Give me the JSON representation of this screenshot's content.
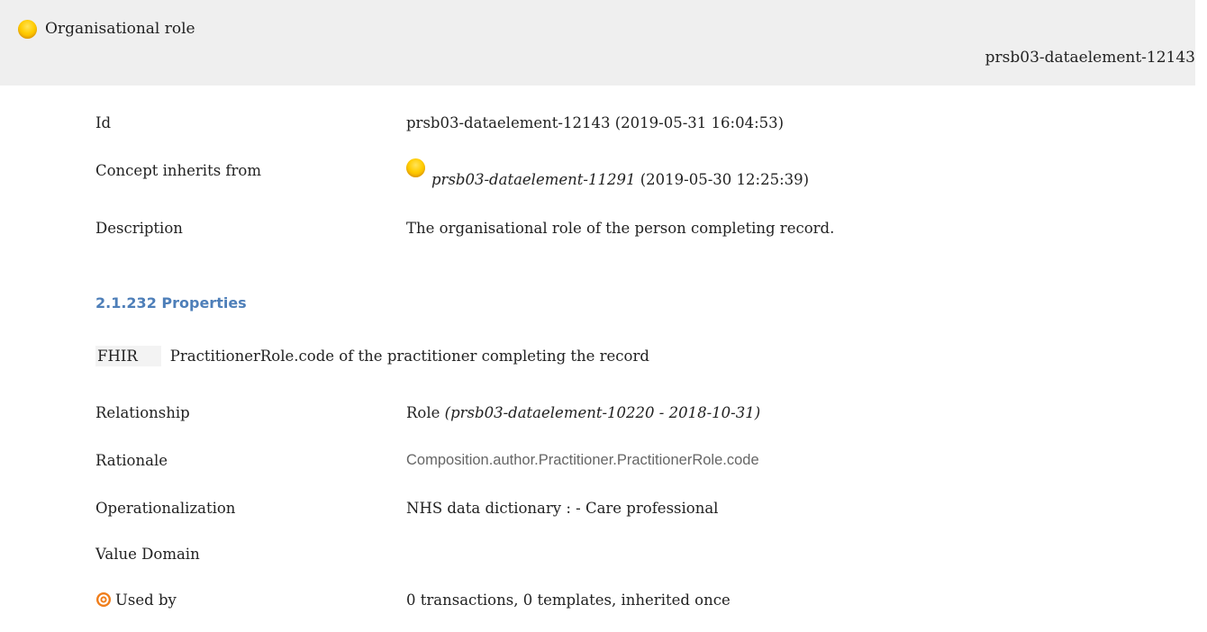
{
  "header": {
    "title": "Organisational role",
    "id": "prsb03-dataelement-12143"
  },
  "details": {
    "id_label": "Id",
    "id_value": "prsb03-dataelement-12143 (2019-05-31 16:04:53)",
    "inherits_label": "Concept inherits from",
    "inherits_id": "prsb03-dataelement-11291",
    "inherits_date": "(2019-05-30 12:25:39)",
    "description_label": "Description",
    "description_value": "The organisational role of the person completing record."
  },
  "properties": {
    "section_title": "2.1.232 Properties",
    "fhir_badge": "FHIR",
    "fhir_text": "PractitionerRole.code of the practitioner completing the record",
    "relationship_label": "Relationship",
    "relationship_value": "Role",
    "relationship_ref": "(prsb03-dataelement-10220 - 2018-10-31)",
    "rationale_label": "Rationale",
    "rationale_value": "Composition.author.Practitioner.PractitionerRole.code",
    "operationalization_label": "Operationalization",
    "operationalization_value": "NHS data dictionary : - Care professional",
    "value_domain_label": "Value Domain",
    "used_by_label": "Used by",
    "used_by_value": "0 transactions, 0 templates, inherited once"
  },
  "icons": {
    "concept_orb": "yellow-orb-icon",
    "used_by": "target-icon"
  },
  "colors": {
    "header_bg": "#efefef",
    "section_title": "#4e7fb9",
    "target_icon": "#f07d1a"
  }
}
